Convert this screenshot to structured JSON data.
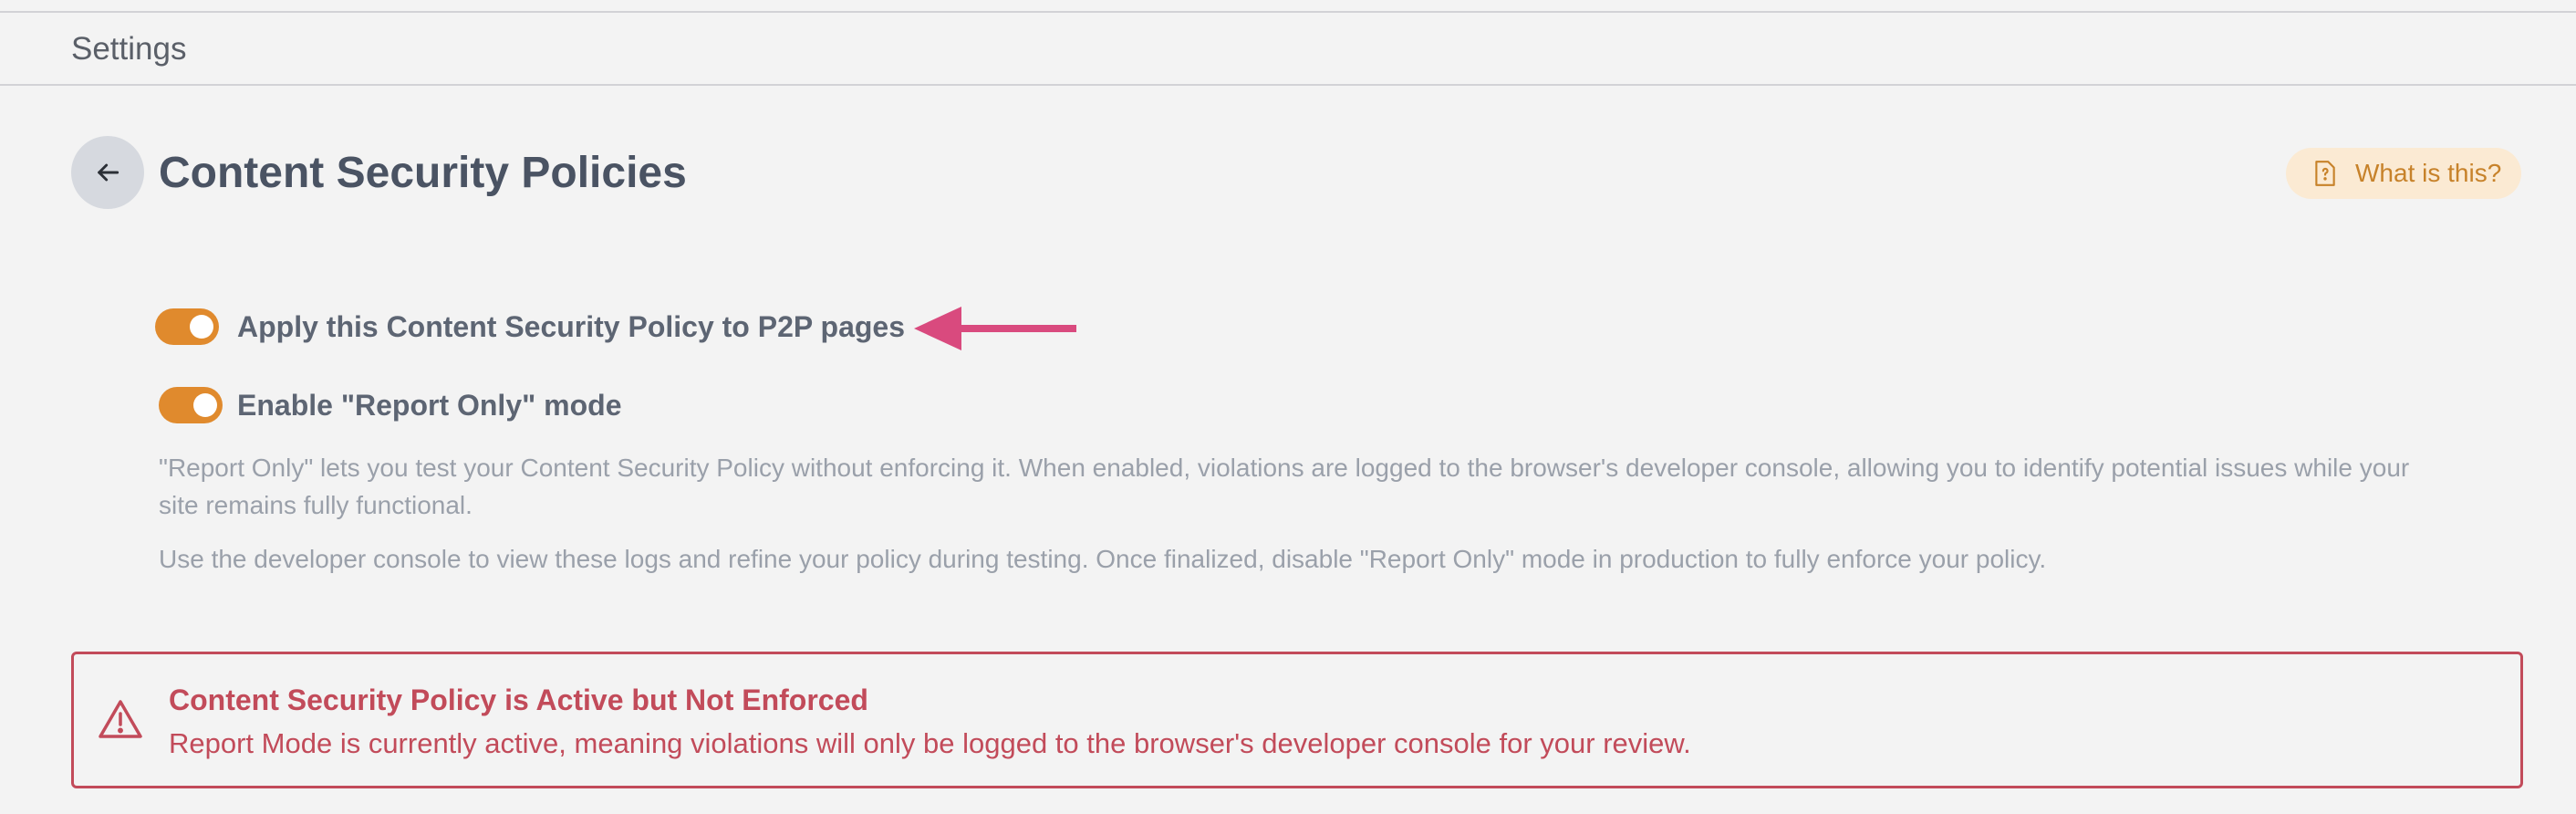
{
  "header": {
    "title": "Settings"
  },
  "page": {
    "title": "Content Security Policies",
    "help_button": "What is this?"
  },
  "toggles": [
    {
      "label": "Apply this Content Security Policy to P2P pages",
      "enabled": true
    },
    {
      "label": "Enable \"Report Only\" mode",
      "enabled": true
    }
  ],
  "descriptions": [
    "\"Report Only\" lets you test your Content Security Policy without enforcing it. When enabled, violations are logged to the browser's developer console, allowing you to identify potential issues while your site remains fully functional.",
    "Use the developer console to view these logs and refine your policy during testing. Once finalized, disable \"Report Only\" mode in production to fully enforce your policy."
  ],
  "alert": {
    "title": "Content Security Policy is Active but Not Enforced",
    "message": "Report Mode is currently active, meaning violations will only be logged to the browser's developer console for your review."
  },
  "colors": {
    "accent": "#e08a2d",
    "danger": "#c24b5a",
    "annotation_arrow": "#d94a7e"
  }
}
